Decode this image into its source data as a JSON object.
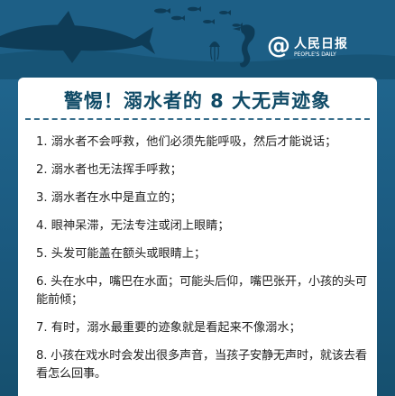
{
  "logo": {
    "symbol": "@",
    "name_cn": "人民日报",
    "name_en": "PEOPLE'S DAILY"
  },
  "illustration": {
    "icons": [
      "shark-icon",
      "fish-school-icon",
      "jellyfish-icon",
      "seahorse-icon"
    ],
    "colors": {
      "sea_dark": "#0e3c57",
      "sea_mid": "#1d5f86",
      "card": "#ffffff",
      "title_text": "#0f4a66"
    }
  },
  "title": "警惕！溺水者的 8 大无声迹象",
  "items": [
    "1. 溺水者不会呼救，他们必须先能呼吸，然后才能说话；",
    "2. 溺水者也无法挥手呼救；",
    "3. 溺水者在水中是直立的；",
    "4. 眼神呆滞，无法专注或闭上眼睛；",
    "5. 头发可能盖在额头或眼睛上；",
    "6. 头在水中，嘴巴在水面；可能头后仰，嘴巴张开，小孩的头可能前倾；",
    "7. 有时，溺水最重要的迹象就是看起来不像溺水；",
    "8. 小孩在戏水时会发出很多声音，当孩子安静无声时，就该去看看怎么回事。"
  ]
}
